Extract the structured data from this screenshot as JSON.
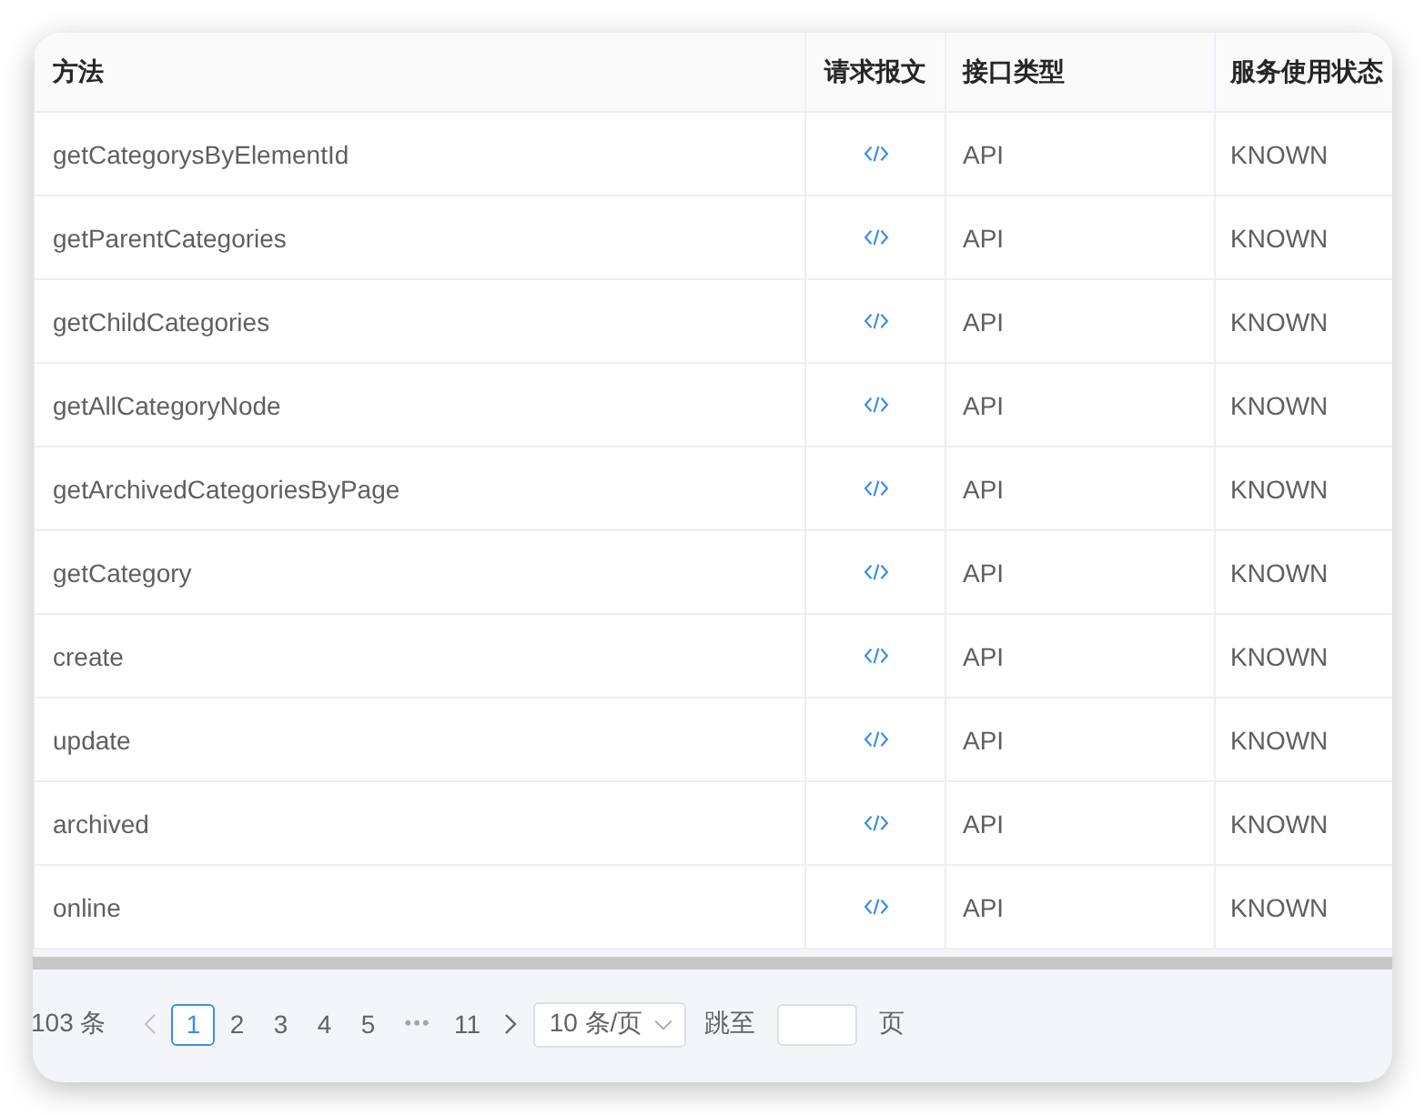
{
  "table": {
    "columns": [
      "方法",
      "请求报文",
      "接口类型",
      "服务使用状态"
    ],
    "rows": [
      {
        "method": "getCategorysByElementId",
        "type": "API",
        "status": "KNOWN"
      },
      {
        "method": "getParentCategories",
        "type": "API",
        "status": "KNOWN"
      },
      {
        "method": "getChildCategories",
        "type": "API",
        "status": "KNOWN"
      },
      {
        "method": "getAllCategoryNode",
        "type": "API",
        "status": "KNOWN"
      },
      {
        "method": "getArchivedCategoriesByPage",
        "type": "API",
        "status": "KNOWN"
      },
      {
        "method": "getCategory",
        "type": "API",
        "status": "KNOWN"
      },
      {
        "method": "create",
        "type": "API",
        "status": "KNOWN"
      },
      {
        "method": "update",
        "type": "API",
        "status": "KNOWN"
      },
      {
        "method": "archived",
        "type": "API",
        "status": "KNOWN"
      },
      {
        "method": "online",
        "type": "API",
        "status": "KNOWN"
      }
    ]
  },
  "pagination": {
    "total": "103 条",
    "pages": [
      {
        "label": "1",
        "selected": true
      },
      {
        "label": "2",
        "selected": false
      },
      {
        "label": "3",
        "selected": false
      },
      {
        "label": "4",
        "selected": false
      },
      {
        "label": "5",
        "selected": false
      },
      {
        "label": "11",
        "selected": false
      }
    ],
    "ellipsis": "•••",
    "page_size": "10 条/页",
    "jump_label": "跳至",
    "page_unit": "页"
  }
}
